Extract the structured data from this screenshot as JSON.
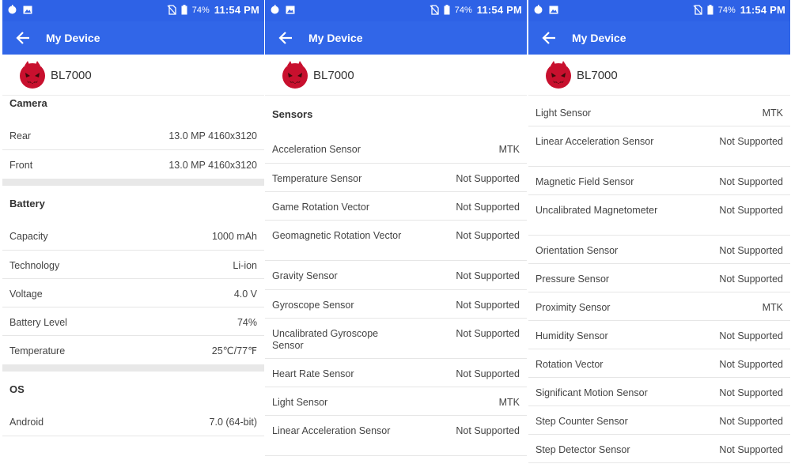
{
  "status": {
    "battery_percent": "74%",
    "time": "11:54 PM"
  },
  "appbar": {
    "title": "My Device"
  },
  "device": {
    "name": "BL7000"
  },
  "panel1": {
    "camera": {
      "title": "Camera",
      "rows": [
        {
          "label": "Rear",
          "value": "13.0 MP 4160x3120"
        },
        {
          "label": "Front",
          "value": "13.0 MP 4160x3120"
        }
      ]
    },
    "battery": {
      "title": "Battery",
      "rows": [
        {
          "label": "Capacity",
          "value": "1000 mAh"
        },
        {
          "label": "Technology",
          "value": "Li-ion"
        },
        {
          "label": "Voltage",
          "value": "4.0 V"
        },
        {
          "label": "Battery Level",
          "value": "74%"
        },
        {
          "label": "Temperature",
          "value": "25℃/77℉"
        }
      ]
    },
    "os": {
      "title": "OS",
      "rows": [
        {
          "label": "Android",
          "value": "7.0 (64-bit)"
        }
      ]
    }
  },
  "panel2": {
    "sensors": {
      "title": "Sensors",
      "rows": [
        {
          "label": "Acceleration Sensor",
          "value": "MTK"
        },
        {
          "label": "Temperature Sensor",
          "value": "Not Supported"
        },
        {
          "label": "Game Rotation Vector",
          "value": "Not Supported"
        },
        {
          "label": "Geomagnetic Rotation Vector",
          "value": "Not Supported"
        },
        {
          "label": "Gravity Sensor",
          "value": "Not Supported"
        },
        {
          "label": "Gyroscope Sensor",
          "value": "Not Supported"
        },
        {
          "label": "Uncalibrated Gyroscope Sensor",
          "value": "Not Supported"
        },
        {
          "label": "Heart Rate Sensor",
          "value": "Not Supported"
        },
        {
          "label": "Light Sensor",
          "value": "MTK"
        },
        {
          "label": "Linear Acceleration Sensor",
          "value": "Not Supported"
        }
      ]
    }
  },
  "panel3": {
    "rows": [
      {
        "label": "Light Sensor",
        "value": "MTK"
      },
      {
        "label": "Linear Acceleration Sensor",
        "value": "Not Supported"
      },
      {
        "label": "Magnetic Field Sensor",
        "value": "Not Supported"
      },
      {
        "label": "Uncalibrated Magnetometer",
        "value": "Not Supported"
      },
      {
        "label": "Orientation Sensor",
        "value": "Not Supported"
      },
      {
        "label": "Pressure Sensor",
        "value": "Not Supported"
      },
      {
        "label": "Proximity Sensor",
        "value": "MTK"
      },
      {
        "label": "Humidity Sensor",
        "value": "Not Supported"
      },
      {
        "label": "Rotation Vector",
        "value": "Not Supported"
      },
      {
        "label": "Significant Motion Sensor",
        "value": "Not Supported"
      },
      {
        "label": "Step Counter Sensor",
        "value": "Not Supported"
      },
      {
        "label": "Step Detector Sensor",
        "value": "Not Supported"
      }
    ]
  },
  "icons": {
    "status_left": [
      "app-notification-icon",
      "image-notification-icon"
    ],
    "status_right": [
      "no-sim-icon",
      "battery-icon"
    ],
    "appbar": "back-arrow-icon",
    "device": "antutu-logo-icon"
  },
  "colors": {
    "status_bar": "#2e62e6",
    "app_bar": "#3166e8",
    "logo_red": "#c8102e",
    "separator": "#e8e8e8"
  }
}
